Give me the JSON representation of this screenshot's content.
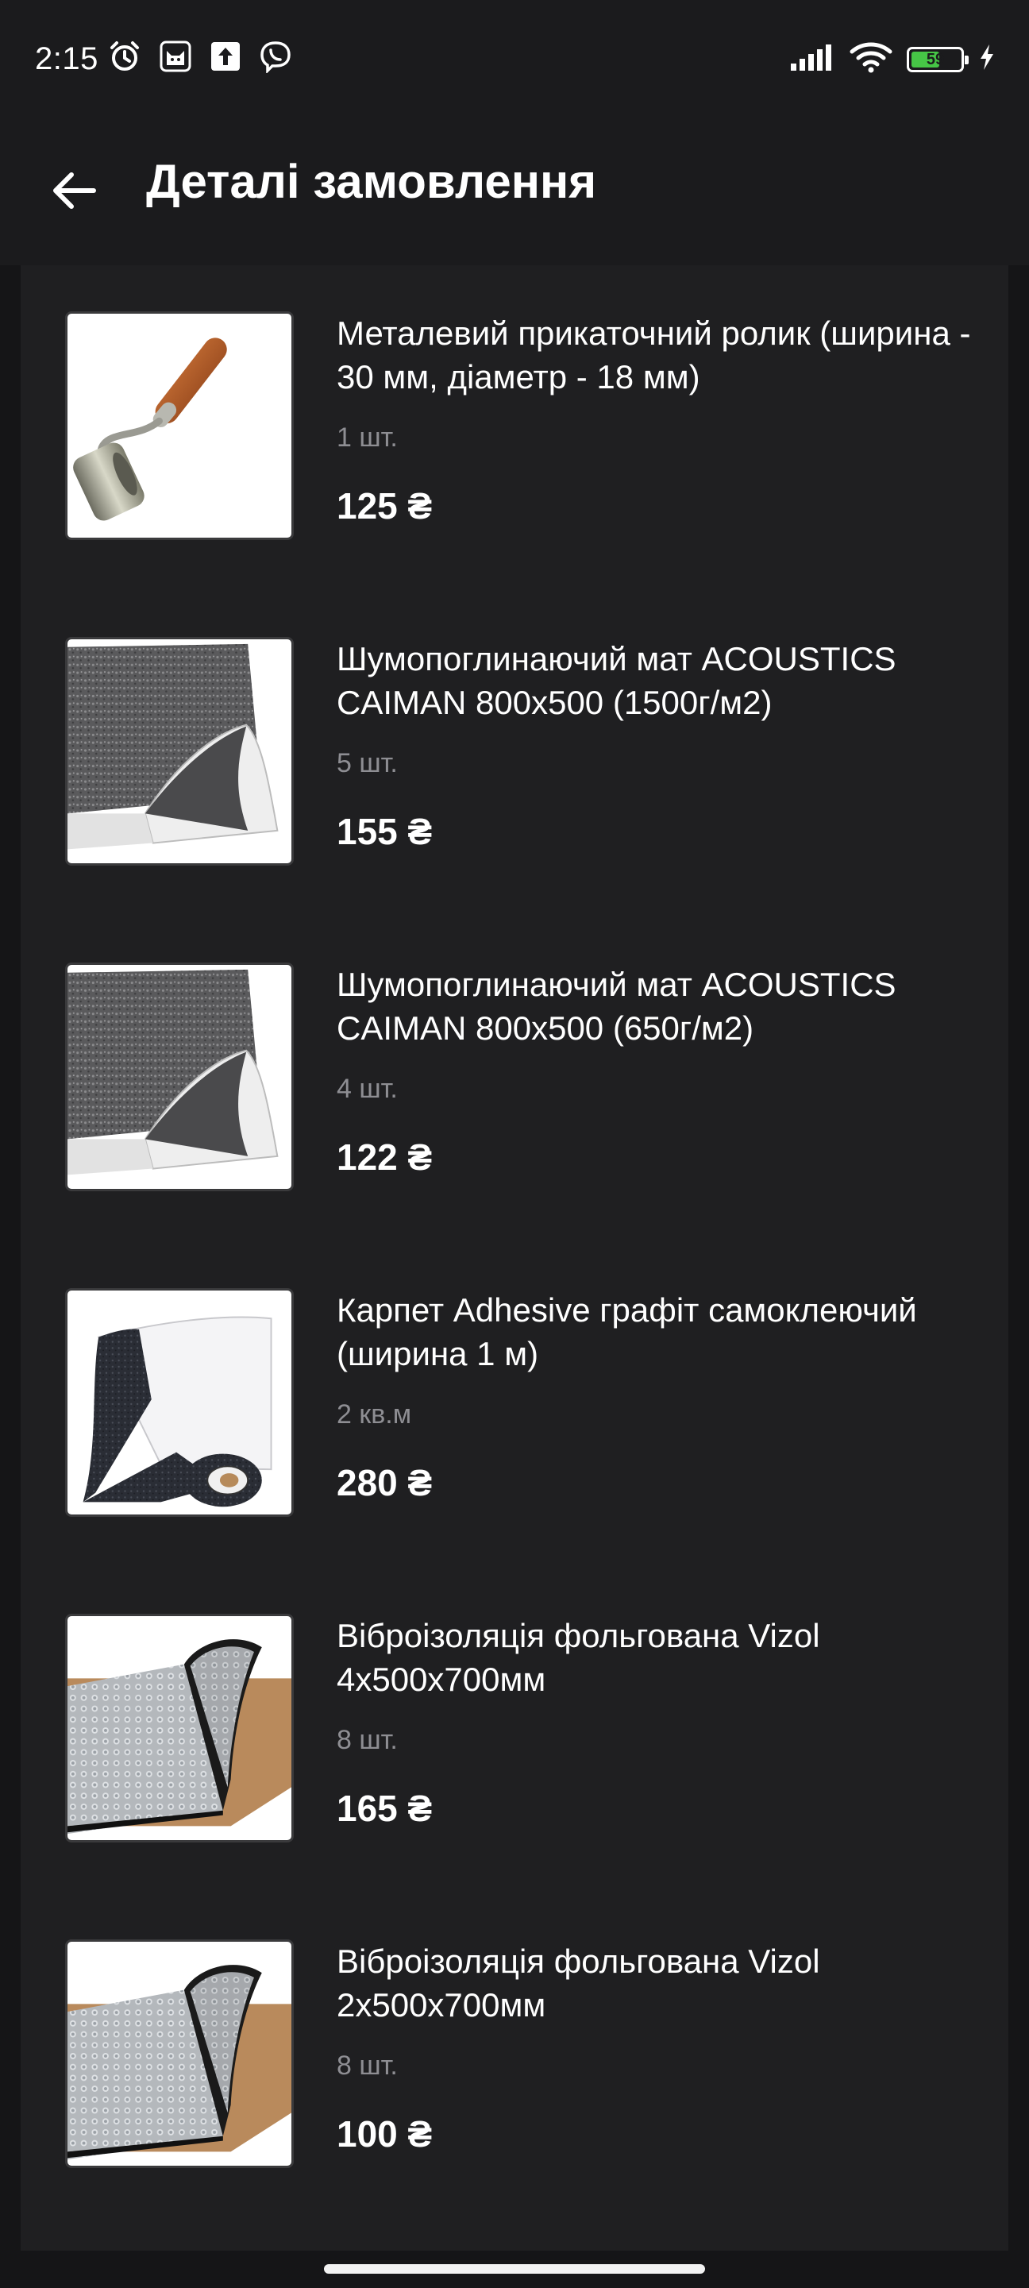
{
  "status_bar": {
    "time": "2:15",
    "left_icons": [
      "alarm-icon",
      "cat-app-icon",
      "upload-icon",
      "viber-icon"
    ],
    "right_icons": [
      "signal-icon",
      "wifi-icon",
      "battery-icon",
      "charging-icon"
    ],
    "battery_percent": "59",
    "battery_level": 0.59,
    "battery_color": "#46c646"
  },
  "header": {
    "back_icon": "arrow-left-icon",
    "title": "Деталі замовлення"
  },
  "order_items": [
    {
      "name": "Металевий прикаточний ролик (ширина - 30 мм, діаметр - 18 мм)",
      "quantity": "1 шт.",
      "price": "125 ₴",
      "image": "roller-icon"
    },
    {
      "name": "Шумопоглинаючий мат ACOUSTICS CAIMAN 800x500 (1500г/м2)",
      "quantity": "5 шт.",
      "price": "155 ₴",
      "image": "felt-mat-icon"
    },
    {
      "name": "Шумопоглинаючий мат ACOUSTICS CAIMAN 800x500 (650г/м2)",
      "quantity": "4 шт.",
      "price": "122 ₴",
      "image": "felt-mat-icon"
    },
    {
      "name": "Карпет Adhesive графіт самоклеючий (ширина 1 м)",
      "quantity": "2 кв.м",
      "price": "280 ₴",
      "image": "carpet-roll-icon"
    },
    {
      "name": "Віброізоляція фольгована Vizol 4x500x700мм",
      "quantity": "8 шт.",
      "price": "165 ₴",
      "image": "foil-sheet-icon"
    },
    {
      "name": "Віброізоляція фольгована Vizol 2x500x700мм",
      "quantity": "8 шт.",
      "price": "100 ₴",
      "image": "foil-sheet-icon"
    }
  ],
  "colors": {
    "background": "#151517",
    "panel": "#1f1f21",
    "header": "#1b1b1d",
    "text_primary": "#ffffff",
    "text_secondary": "#8e8e93"
  }
}
